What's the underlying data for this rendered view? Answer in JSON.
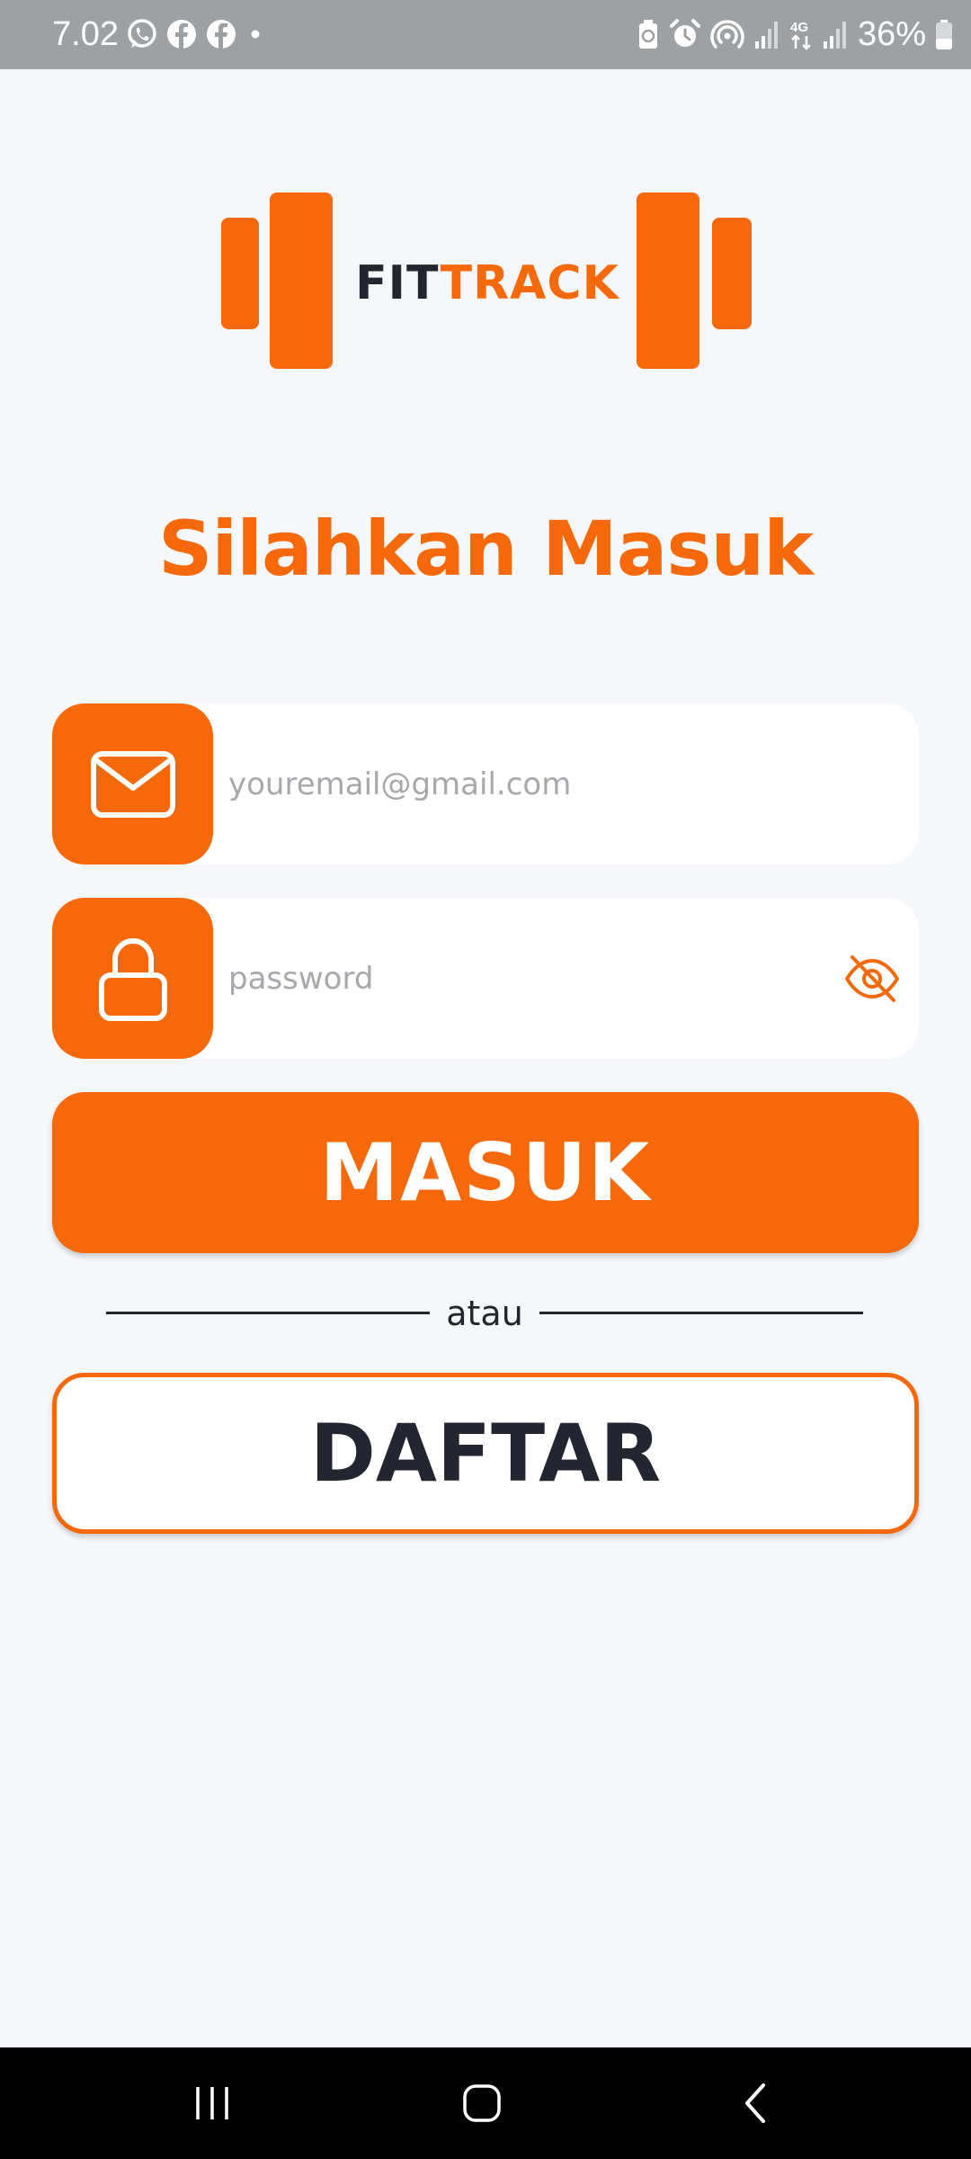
{
  "status_bar": {
    "time": "7.02",
    "battery_percent": "36%",
    "left_icons": [
      "whatsapp-icon",
      "facebook-icon",
      "facebook-icon",
      "dot-icon"
    ],
    "right_icons": [
      "battery-saver-icon",
      "alarm-icon",
      "hotspot-icon",
      "signal-icon",
      "4g-icon",
      "signal-icon",
      "battery-icon"
    ]
  },
  "logo": {
    "part1": "FIT",
    "part2": "TRACK"
  },
  "login": {
    "title": "Silahkan Masuk"
  },
  "email_field": {
    "icon": "mail-icon",
    "placeholder": "youremail@gmail.com",
    "value": ""
  },
  "password_field": {
    "icon": "lock-icon",
    "placeholder": "password",
    "value": "",
    "toggle_icon": "eye-off-icon"
  },
  "buttons": {
    "login_label": "MASUK",
    "divider_label": "atau",
    "register_label": "DAFTAR"
  },
  "nav_bar": {
    "icons": [
      "recent-apps-icon",
      "home-icon",
      "back-icon"
    ]
  },
  "colors": {
    "accent": "#f5690b",
    "dark": "#23252f",
    "background": "#f5f7fa",
    "status_bar": "#9ea1a3",
    "nav_bar": "#000000"
  }
}
